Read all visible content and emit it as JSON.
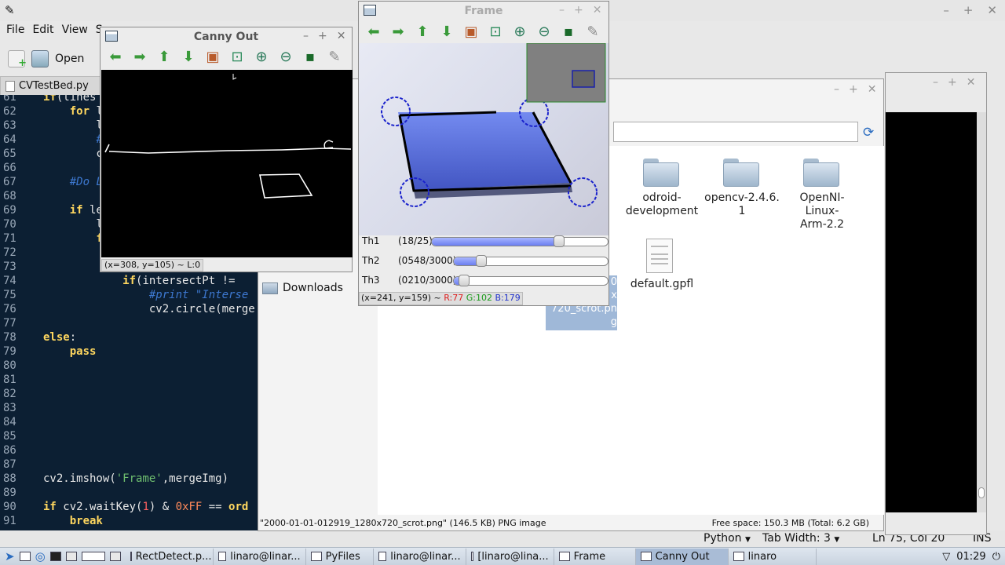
{
  "editor": {
    "menu": [
      "File",
      "Edit",
      "View",
      "S"
    ],
    "toolbar_open": "Open",
    "tab_label": "CVTestBed.py",
    "lines": [
      {
        "n": "61",
        "t": "if(lines"
      },
      {
        "n": "62",
        "t": "    for l"
      },
      {
        "n": "63",
        "t": "        li"
      },
      {
        "n": "64",
        "t": "        #d"
      },
      {
        "n": "65",
        "t": "        cv"
      },
      {
        "n": "66",
        "t": ""
      },
      {
        "n": "67",
        "t": "    #Do L"
      },
      {
        "n": "68",
        "t": ""
      },
      {
        "n": "69",
        "t": "    if le"
      },
      {
        "n": "70",
        "t": "        li"
      },
      {
        "n": "71",
        "t": "        fo"
      },
      {
        "n": "72",
        "t": ""
      },
      {
        "n": "73",
        "t": ""
      },
      {
        "n": "74",
        "t": "            if(intersectPt != "
      },
      {
        "n": "75",
        "t": "                #print \"Interse"
      },
      {
        "n": "76",
        "t": "                cv2.circle(merge"
      },
      {
        "n": "77",
        "t": ""
      },
      {
        "n": "78",
        "t": "else:"
      },
      {
        "n": "79",
        "t": "    pass"
      },
      {
        "n": "80",
        "t": ""
      },
      {
        "n": "81",
        "t": ""
      },
      {
        "n": "82",
        "t": ""
      },
      {
        "n": "83",
        "t": ""
      },
      {
        "n": "84",
        "t": ""
      },
      {
        "n": "85",
        "t": ""
      },
      {
        "n": "86",
        "t": ""
      },
      {
        "n": "87",
        "t": ""
      },
      {
        "n": "88",
        "t": "cv2.imshow('Frame',mergeImg)"
      },
      {
        "n": "89",
        "t": ""
      },
      {
        "n": "90",
        "t": "if cv2.waitKey(1) & 0xFF == ord"
      },
      {
        "n": "91",
        "t": "    break"
      }
    ],
    "status": {
      "filetype": "Python",
      "tab_width": "Tab Width: 3",
      "position": "Ln 75, Col 20",
      "mode": "INS"
    }
  },
  "filemanager": {
    "sidebar_downloads": "Downloads",
    "folders": [
      {
        "label": "odroid-\ndevelopment"
      },
      {
        "label": "opencv-2.4.6.\n1"
      },
      {
        "label": "OpenNI-\nLinux-\nArm-2.2"
      }
    ],
    "file": {
      "label": "default.gpfl"
    },
    "selected_file_partial": "0\nx\n720_scrot.pn\ng",
    "status_left": "\"2000-01-01-012919_1280x720_scrot.png\" (146.5 KB) PNG image",
    "status_right": "Free space: 150.3 MB (Total: 6.2 GB)"
  },
  "canny": {
    "title": "Canny Out",
    "status": "(x=308, y=105) ~ L:0"
  },
  "frame": {
    "title": "Frame",
    "sliders": [
      {
        "name": "Th1",
        "value": "(18/25)",
        "fraction": 0.72
      },
      {
        "name": "Th2",
        "value": "(0548/3000)",
        "fraction": 0.183
      },
      {
        "name": "Th3",
        "value": "(0210/3000)",
        "fraction": 0.07
      }
    ],
    "status_xy": "(x=241, y=159) ~",
    "status_r": "R:77",
    "status_g": "G:102",
    "status_b": "B:179"
  },
  "taskbar": {
    "items": [
      "RectDetect.p...",
      "linaro@linar...",
      "PyFiles",
      "linaro@linar...",
      "[linaro@lina...",
      "Frame",
      "Canny Out",
      "linaro"
    ],
    "active_index": 6,
    "clock": "01:29"
  },
  "colors": {
    "code_bg": "#0c1f33",
    "accent_blue": "#2233cc"
  }
}
